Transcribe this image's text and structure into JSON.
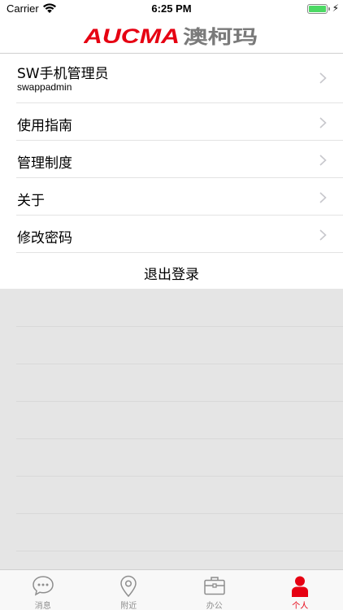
{
  "status_bar": {
    "carrier": "Carrier",
    "time": "6:25 PM",
    "battery_level": 1.0
  },
  "header": {
    "logo_latin": "AUCMA",
    "logo_chinese": "澳柯玛",
    "brand_red": "#e60012",
    "brand_grey": "#7a7a7a"
  },
  "profile": {
    "name": "SW手机管理员",
    "username": "swappadmin"
  },
  "menu": {
    "items": [
      {
        "label": "使用指南"
      },
      {
        "label": "管理制度"
      },
      {
        "label": "关于"
      },
      {
        "label": "修改密码"
      }
    ],
    "logout_label": "退出登录"
  },
  "tabs": [
    {
      "label": "消息",
      "icon": "message-icon",
      "active": false
    },
    {
      "label": "附近",
      "icon": "location-pin-icon",
      "active": false
    },
    {
      "label": "办公",
      "icon": "briefcase-icon",
      "active": false
    },
    {
      "label": "个人",
      "icon": "person-icon",
      "active": true
    }
  ]
}
